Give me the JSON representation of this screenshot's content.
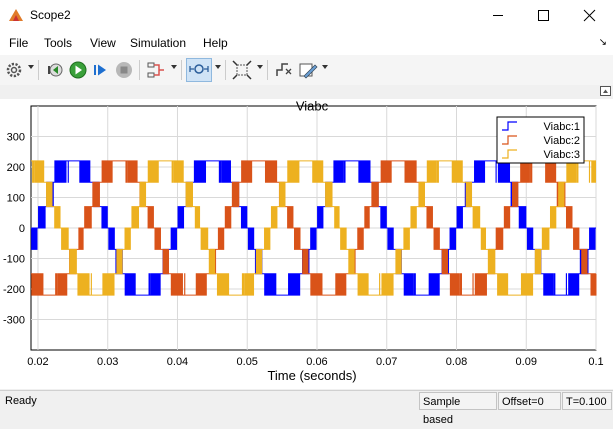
{
  "window": {
    "title": "Scope2"
  },
  "menu": {
    "items": [
      "File",
      "Tools",
      "View",
      "Simulation",
      "Help"
    ]
  },
  "chart_data": {
    "type": "line",
    "title": "Viabc",
    "xlabel": "Time (seconds)",
    "ylabel": "",
    "xlim": [
      0.019,
      0.1
    ],
    "ylim": [
      -400,
      400
    ],
    "xticks": [
      0.02,
      0.03,
      0.04,
      0.05,
      0.06,
      0.07,
      0.08,
      0.09,
      0.1
    ],
    "xtick_labels": [
      "0.02",
      "0.03",
      "0.04",
      "0.05",
      "0.06",
      "0.07",
      "0.08",
      "0.09",
      "0.1"
    ],
    "yticks": [
      -300,
      -200,
      -100,
      0,
      100,
      200,
      300
    ],
    "ytick_labels": [
      "-300",
      "-200",
      "-100",
      "0",
      "100",
      "200",
      "300"
    ],
    "grid": true,
    "legend_position": "top-right",
    "fundamental_hz": 50,
    "level_values": [
      -220,
      -150,
      -70,
      0,
      70,
      150,
      220
    ],
    "series": [
      {
        "name": "Viabc:1",
        "color": "#0000ff",
        "phase_deg": 0
      },
      {
        "name": "Viabc:2",
        "color": "#d95319",
        "phase_deg": -120
      },
      {
        "name": "Viabc:3",
        "color": "#edb120",
        "phase_deg": 120
      }
    ]
  },
  "status": {
    "ready": "Ready",
    "sample_mode": "Sample based",
    "offset": "Offset=0",
    "time": "T=0.100"
  }
}
